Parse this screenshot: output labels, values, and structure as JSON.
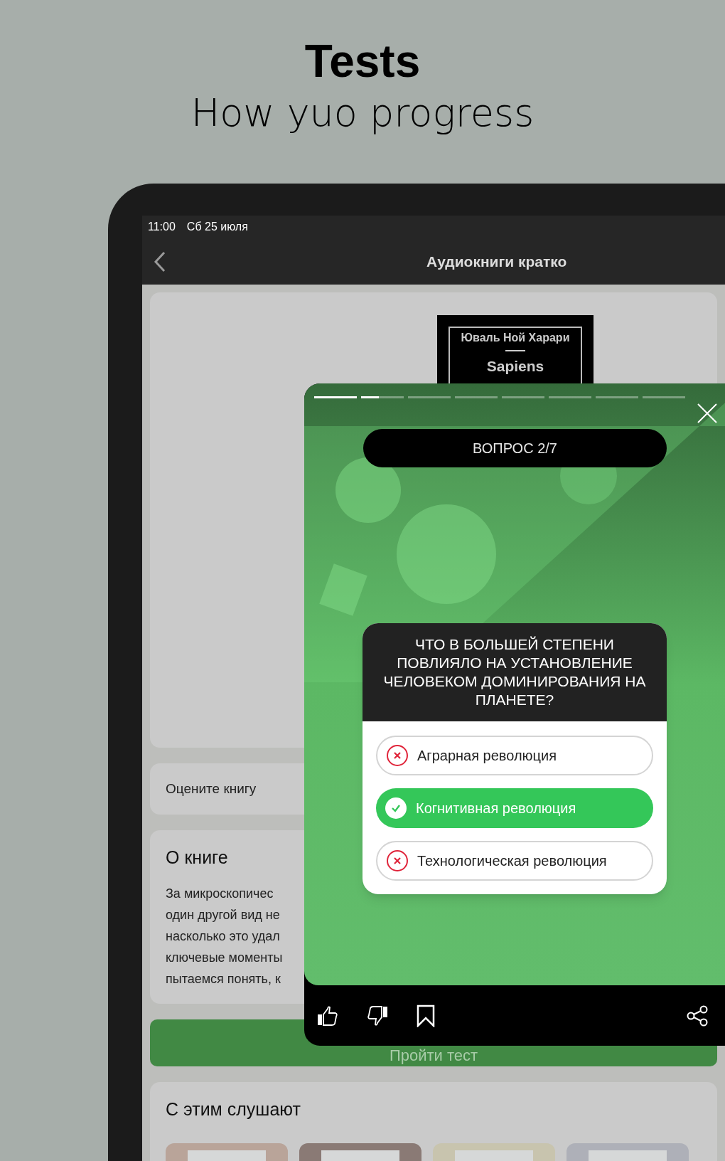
{
  "promo": {
    "title": "Tests",
    "subtitle": "How yuo progress"
  },
  "status_bar": {
    "time": "11:00",
    "date": "Сб 25 июля"
  },
  "nav_bar": {
    "title": "Аудиокниги кратко"
  },
  "book_cover": {
    "author": "Юваль Ной Харари",
    "title": "Sapiens"
  },
  "rate_card": {
    "label": "Оцените книгу"
  },
  "about_card": {
    "heading": "О книге",
    "lines": [
      "За микроскопичес",
      "один другой вид не",
      "насколько это удал",
      "ключевые моменты",
      "пытаемся понять, к"
    ]
  },
  "test_button": {
    "label": "Пройти тест"
  },
  "related_card": {
    "heading": "С этим слушают",
    "covers": [
      {
        "color": "#b9a499"
      },
      {
        "color": "#8a7a75"
      },
      {
        "color": "#c8c4ae"
      },
      {
        "color": "#aeb0b8"
      }
    ]
  },
  "quiz": {
    "progress": {
      "level": 0.175
    },
    "counter": "ВОПРОС 2/7",
    "question": "ЧТО В БОЛЬШЕЙ СТЕПЕНИ ПОВЛИЯЛО НА УСТАНОВЛЕНИЕ ЧЕЛОВЕКОМ ДОМИНИРОВАНИЯ НА ПЛАНЕТЕ?",
    "answers": [
      {
        "label": "Аграрная революция",
        "kind": "wrong"
      },
      {
        "label": "Когнитивная революция",
        "kind": "correct"
      },
      {
        "label": "Технологическая революция",
        "kind": "wrong"
      }
    ]
  }
}
